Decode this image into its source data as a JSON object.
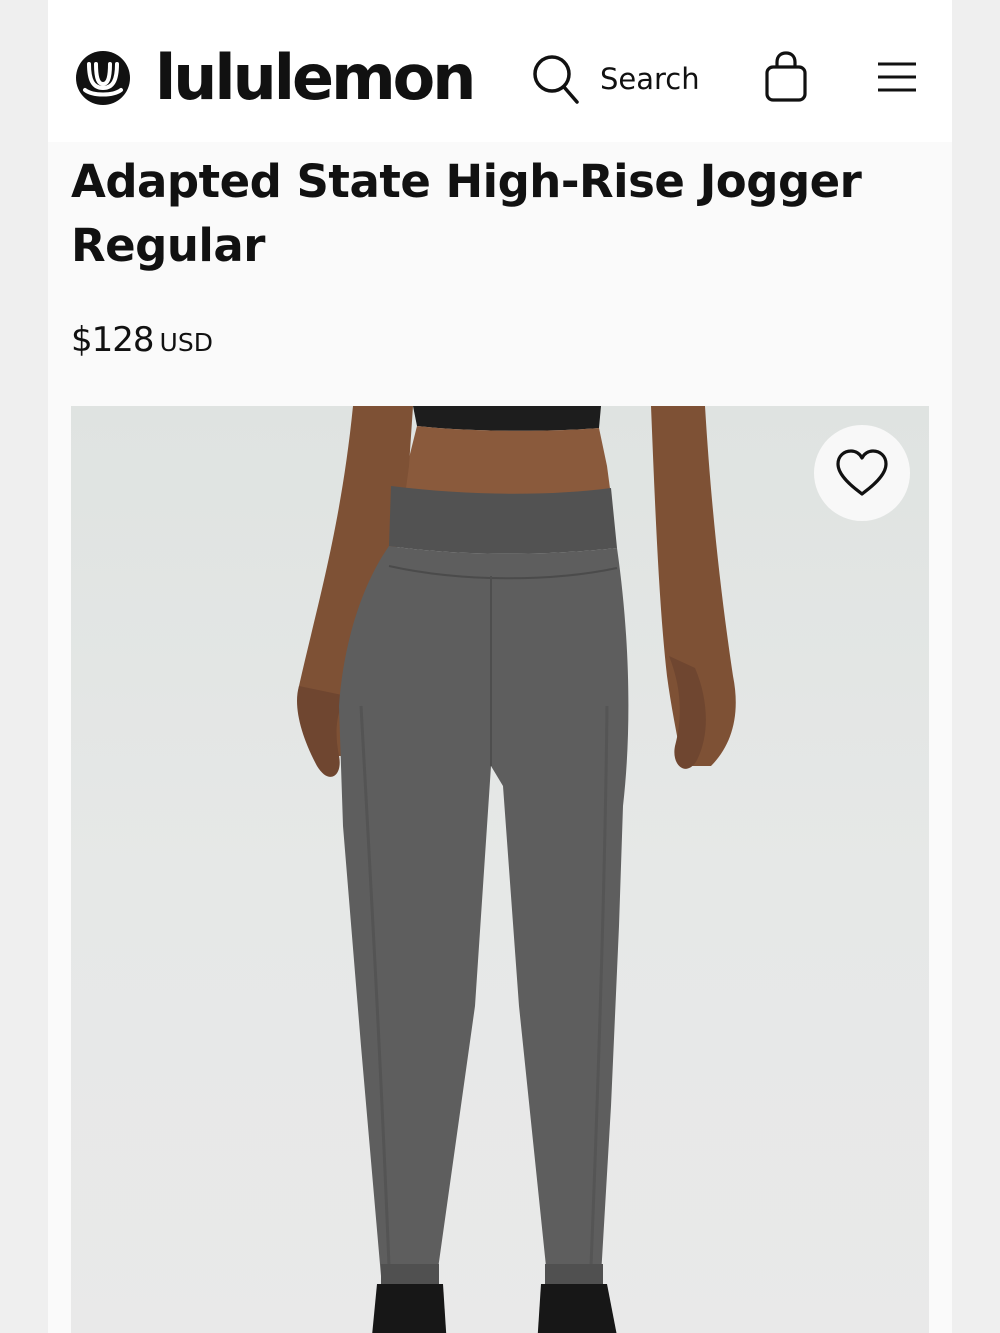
{
  "header": {
    "brand": "lululemon",
    "search_label": "Search",
    "icons": {
      "logo": "lululemon-logo-icon",
      "search": "search-icon",
      "bag": "shopping-bag-icon",
      "menu": "hamburger-menu-icon"
    }
  },
  "product": {
    "title": "Adapted State High-Rise Jogger Regular",
    "price": "$128",
    "currency": "USD",
    "wishlist_icon": "heart-outline-icon"
  },
  "colors": {
    "text": "#111111",
    "header_bg": "#ffffff",
    "page_bg": "#fafafa",
    "product_gray": "#5d5d5d"
  }
}
